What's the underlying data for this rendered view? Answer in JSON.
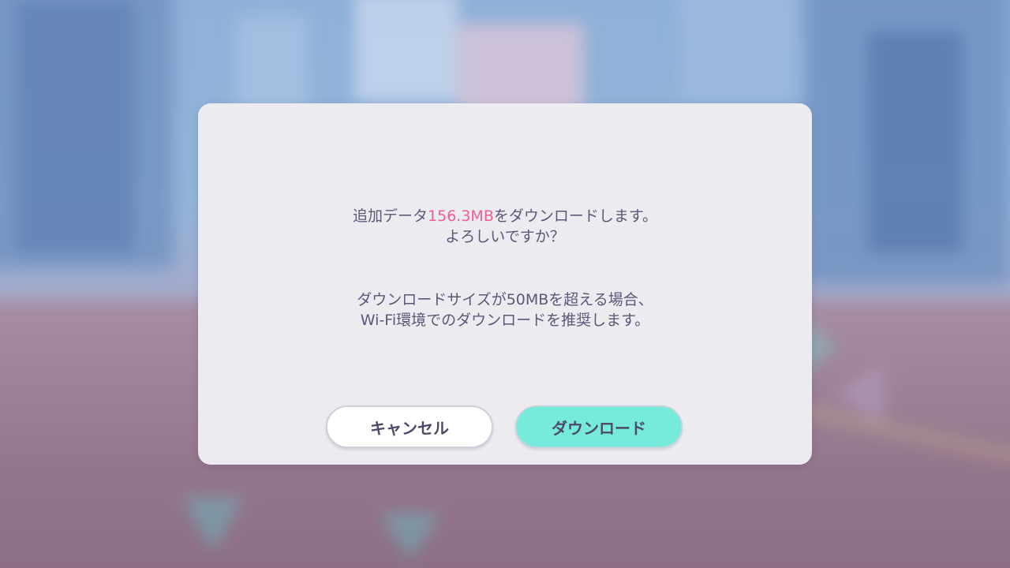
{
  "dialog": {
    "message1": {
      "prefix": "追加データ",
      "size": "156.3MB",
      "suffix": "をダウンロードします。",
      "line2": "よろしいですか？"
    },
    "message2": {
      "line1": "ダウンロードサイズが50MBを超える場合、",
      "line2": "Wi-Fi環境でのダウンロードを推奨します。"
    },
    "buttons": {
      "cancel_label": "キャンセル",
      "download_label": "ダウンロード"
    }
  },
  "colors": {
    "highlight": "#ef5e93",
    "text": "#5b5878",
    "download_button": "#76eadb",
    "dialog_bg": "#ebebf0"
  }
}
